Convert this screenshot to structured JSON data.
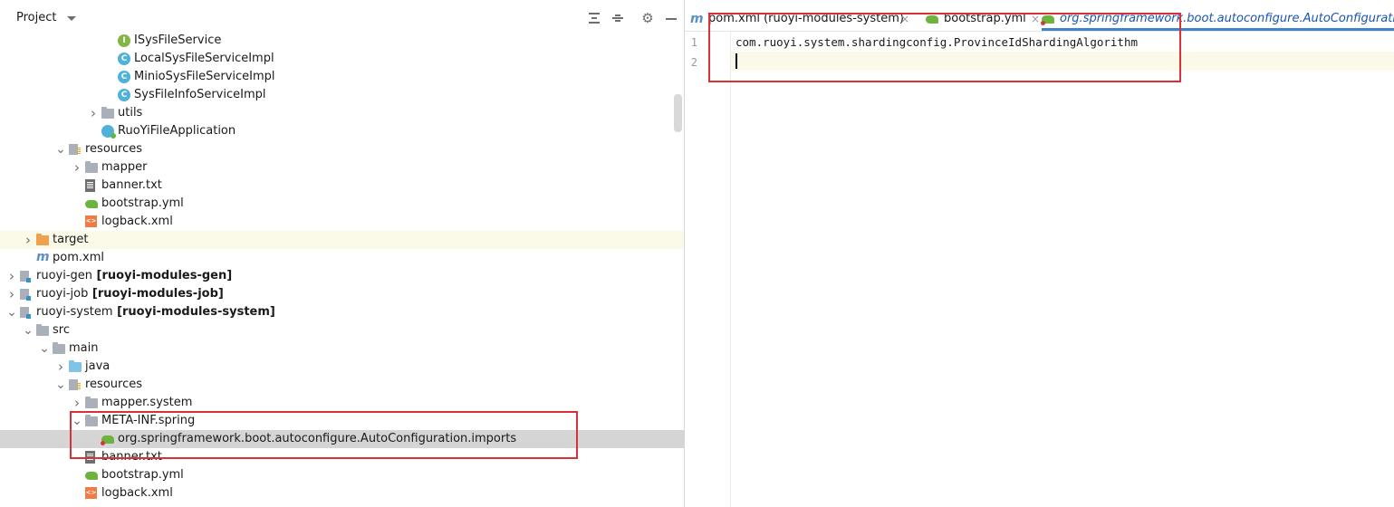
{
  "project_panel": {
    "title": "Project",
    "tree": [
      {
        "label": "ISysFileService",
        "icon": "interface-icon",
        "depth": 8,
        "arrow": "none"
      },
      {
        "label": "LocalSysFileServiceImpl",
        "icon": "class-icon",
        "depth": 8,
        "arrow": "none"
      },
      {
        "label": "MinioSysFileServiceImpl",
        "icon": "class-icon",
        "depth": 8,
        "arrow": "none"
      },
      {
        "label": "SysFileInfoServiceImpl",
        "icon": "class-icon",
        "depth": 8,
        "arrow": "none"
      },
      {
        "label": "utils",
        "icon": "package-folder-icon",
        "depth": 7,
        "arrow": "collapsed"
      },
      {
        "label": "RuoYiFileApplication",
        "icon": "spring-app-icon",
        "depth": 7,
        "arrow": "none"
      },
      {
        "label": "resources",
        "icon": "resources-folder-icon",
        "depth": 5,
        "arrow": "expanded"
      },
      {
        "label": "mapper",
        "icon": "folder-icon",
        "depth": 6,
        "arrow": "collapsed"
      },
      {
        "label": "banner.txt",
        "icon": "text-file-icon",
        "depth": 6,
        "arrow": "none"
      },
      {
        "label": "bootstrap.yml",
        "icon": "yaml-file-icon",
        "depth": 6,
        "arrow": "none"
      },
      {
        "label": "logback.xml",
        "icon": "xml-file-icon",
        "depth": 6,
        "arrow": "none"
      },
      {
        "label": "target",
        "icon": "excluded-folder-icon",
        "depth": 3,
        "arrow": "collapsed",
        "highlight": true
      },
      {
        "label": "pom.xml",
        "icon": "maven-icon",
        "depth": 3,
        "arrow": "none"
      },
      {
        "label": "ruoyi-gen",
        "module": "[ruoyi-modules-gen]",
        "icon": "module-folder-icon",
        "depth": 2,
        "arrow": "collapsed"
      },
      {
        "label": "ruoyi-job",
        "module": "[ruoyi-modules-job]",
        "icon": "module-folder-icon",
        "depth": 2,
        "arrow": "collapsed"
      },
      {
        "label": "ruoyi-system",
        "module": "[ruoyi-modules-system]",
        "icon": "module-folder-icon",
        "depth": 2,
        "arrow": "expanded"
      },
      {
        "label": "src",
        "icon": "folder-icon",
        "depth": 3,
        "arrow": "expanded"
      },
      {
        "label": "main",
        "icon": "folder-icon",
        "depth": 4,
        "arrow": "expanded"
      },
      {
        "label": "java",
        "icon": "source-folder-icon",
        "depth": 5,
        "arrow": "collapsed"
      },
      {
        "label": "resources",
        "icon": "resources-folder-icon",
        "depth": 5,
        "arrow": "expanded"
      },
      {
        "label": "mapper.system",
        "icon": "folder-icon",
        "depth": 6,
        "arrow": "collapsed"
      },
      {
        "label": "META-INF.spring",
        "icon": "folder-icon",
        "depth": 6,
        "arrow": "expanded"
      },
      {
        "label": "org.springframework.boot.autoconfigure.AutoConfiguration.imports",
        "icon": "spring-factories-icon",
        "depth": 7,
        "arrow": "none",
        "selected": true
      },
      {
        "label": "banner.txt",
        "icon": "text-file-icon",
        "depth": 6,
        "arrow": "none"
      },
      {
        "label": "bootstrap.yml",
        "icon": "yaml-file-icon",
        "depth": 6,
        "arrow": "none"
      },
      {
        "label": "logback.xml",
        "icon": "xml-file-icon",
        "depth": 6,
        "arrow": "none"
      }
    ]
  },
  "editor": {
    "tabs": [
      {
        "label": "pom.xml (ruoyi-modules-system)",
        "icon": "maven-icon",
        "close": "×"
      },
      {
        "label": "bootstrap.yml",
        "icon": "yaml-file-icon",
        "close": "×"
      },
      {
        "label": "org.springframework.boot.autoconfigure.AutoConfiguration",
        "icon": "spring-factories-icon",
        "active": true
      }
    ],
    "line_numbers": [
      "1",
      "2"
    ],
    "lines": [
      "com.ruoyi.system.shardingconfig.ProvinceIdShardingAlgorithm",
      ""
    ]
  },
  "colors": {
    "annotation_red": "#d9303a",
    "selection": "#d5d5d5",
    "highlight_row": "#fbf9e8",
    "active_tab_underline": "#4083c9"
  }
}
